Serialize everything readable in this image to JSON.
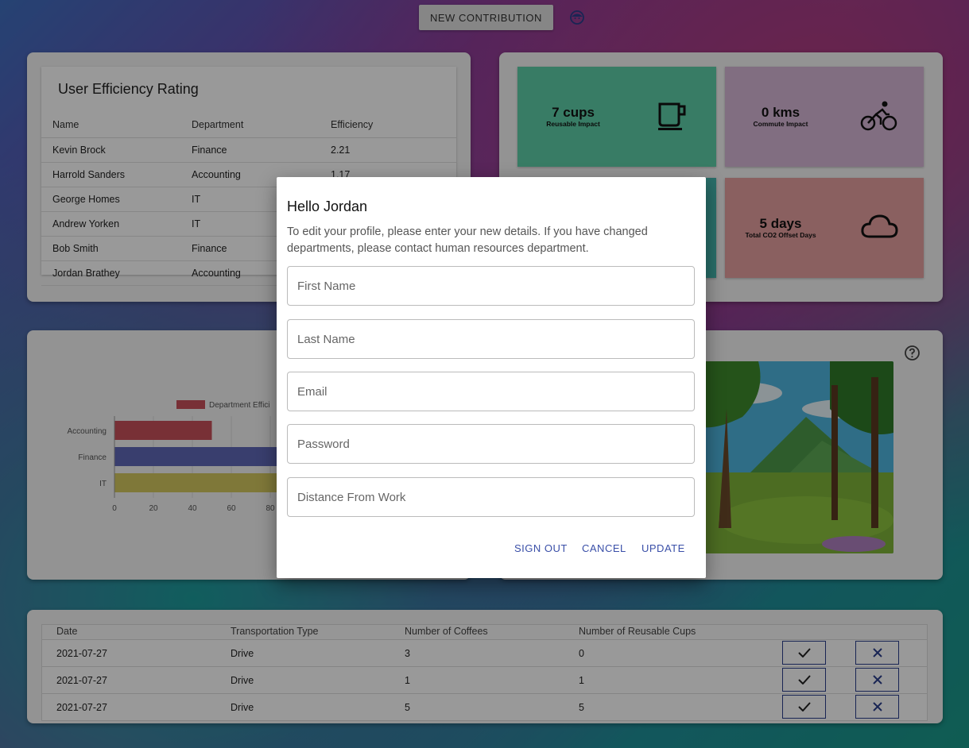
{
  "header": {
    "new_contribution_label": "NEW CONTRIBUTION",
    "avatar_icon": "face-icon"
  },
  "efficiency": {
    "title": "User Efficiency Rating",
    "columns": [
      "Name",
      "Department",
      "Efficiency"
    ],
    "rows": [
      {
        "name": "Kevin Brock",
        "department": "Finance",
        "efficiency": "2.21"
      },
      {
        "name": "Harrold Sanders",
        "department": "Accounting",
        "efficiency": "1.17"
      },
      {
        "name": "George Homes",
        "department": "IT",
        "efficiency": ""
      },
      {
        "name": "Andrew Yorken",
        "department": "IT",
        "efficiency": ""
      },
      {
        "name": "Bob Smith",
        "department": "Finance",
        "efficiency": ""
      },
      {
        "name": "Jordan Brathey",
        "department": "Accounting",
        "efficiency": ""
      }
    ]
  },
  "tiles": [
    {
      "value": "7 cups",
      "label": "Reusable Impact",
      "icon": "coffee-cup-icon",
      "color": "#5ecfa8"
    },
    {
      "value": "0 kms",
      "label": "Commute Impact",
      "icon": "bicycle-icon",
      "color": "#d8b8d8"
    },
    {
      "value": "",
      "label": "",
      "icon": "",
      "color": "#45b7b0"
    },
    {
      "value": "5 days",
      "label": "Total CO2 Offset Days",
      "icon": "cloud-icon",
      "color": "#e7a0a0"
    }
  ],
  "chart_data": {
    "type": "bar",
    "orientation": "horizontal",
    "categories": [
      "Accounting",
      "Finance",
      "IT"
    ],
    "series": [
      {
        "name": "Department Effici",
        "values": [
          50,
          90,
          90
        ]
      }
    ],
    "xticks": [
      "0",
      "20",
      "40",
      "60",
      "80"
    ],
    "colors": [
      "#c9505a",
      "#5f68b8",
      "#d4c860"
    ],
    "legend_position": "top"
  },
  "contributions": {
    "columns": [
      "Date",
      "Transportation Type",
      "Number of Coffees",
      "Number of Reusable Cups"
    ],
    "rows": [
      {
        "date": "2021-07-27",
        "transport": "Drive",
        "coffees": "3",
        "cups": "0"
      },
      {
        "date": "2021-07-27",
        "transport": "Drive",
        "coffees": "1",
        "cups": "1"
      },
      {
        "date": "2021-07-27",
        "transport": "Drive",
        "coffees": "5",
        "cups": "5"
      }
    ],
    "approve_icon": "check-icon",
    "reject_icon": "close-icon"
  },
  "modal": {
    "title": "Hello Jordan",
    "description": "To edit your profile, please enter your new details. If you have changed departments, please contact human resources department.",
    "fields": {
      "first_name": "First Name",
      "last_name": "Last Name",
      "email": "Email",
      "password": "Password",
      "distance": "Distance From Work"
    },
    "sign_out_label": "SIGN OUT",
    "cancel_label": "CANCEL",
    "update_label": "UPDATE"
  }
}
